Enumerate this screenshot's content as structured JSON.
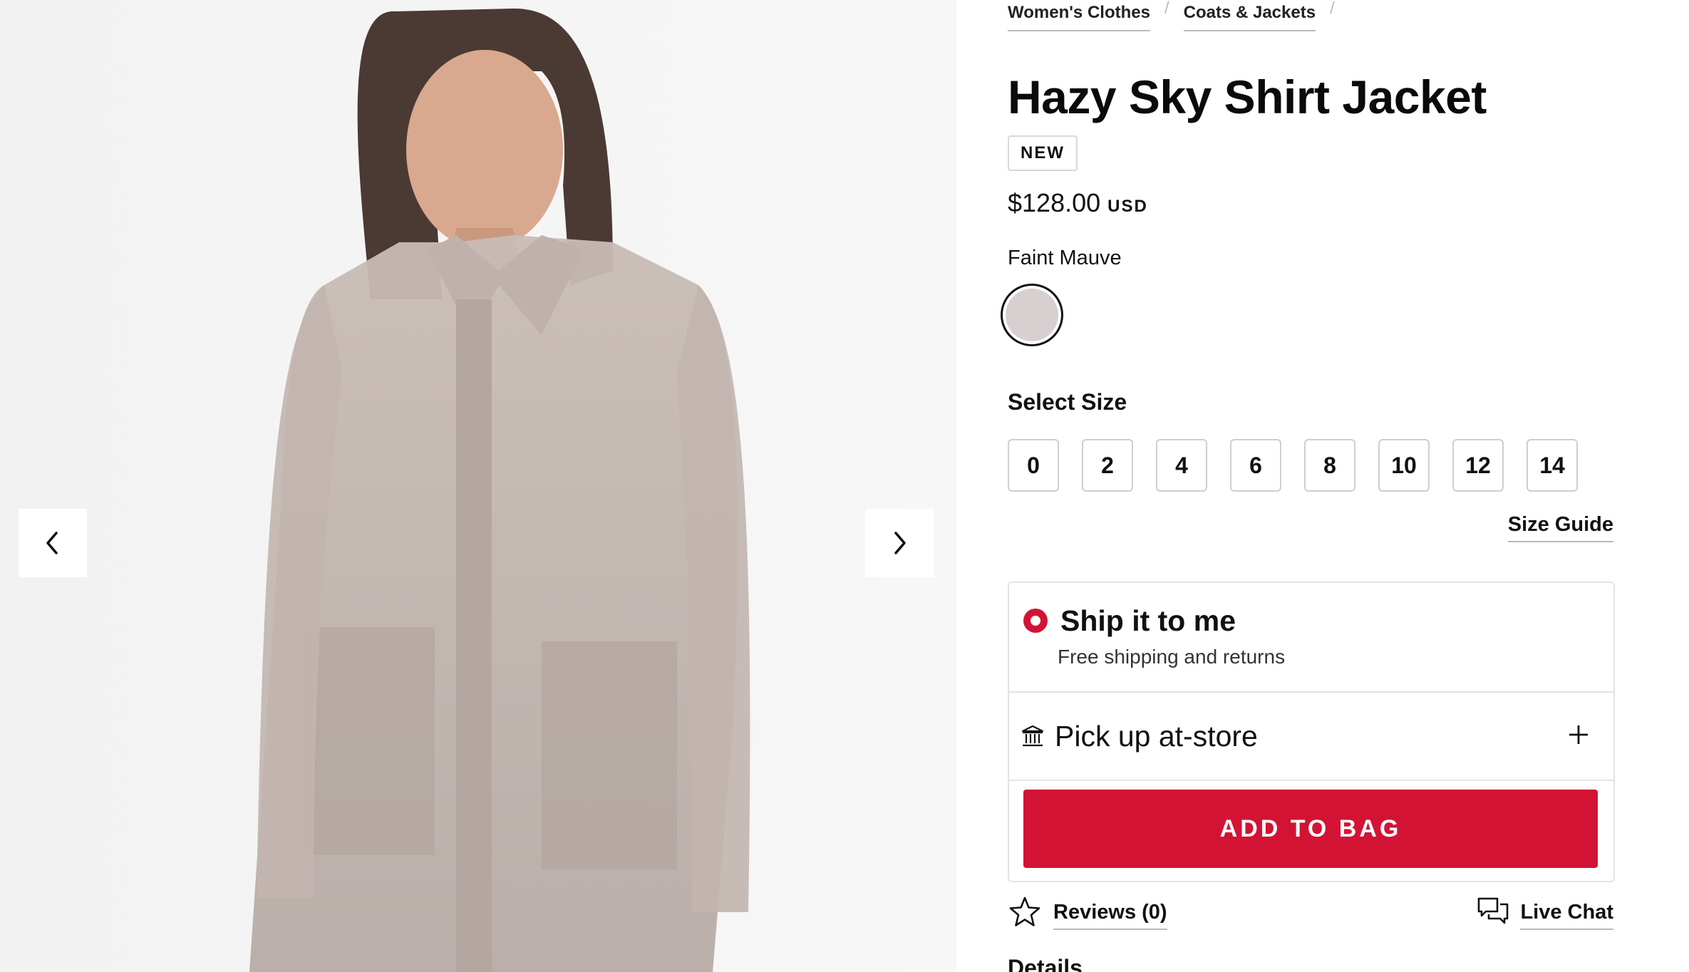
{
  "gallery": {
    "prev_icon": "chevron-left-icon",
    "next_icon": "chevron-right-icon"
  },
  "breadcrumb": [
    "Women's Clothes",
    "Coats & Jackets"
  ],
  "breadcrumb_separator": "/",
  "product": {
    "title": "Hazy Sky Shirt Jacket",
    "badge": "NEW",
    "price": "$128.00",
    "currency": "USD",
    "color_name": "Faint Mauve",
    "swatch_color": "#d8d0d0"
  },
  "size": {
    "label": "Select Size",
    "options": [
      "0",
      "2",
      "4",
      "6",
      "8",
      "10",
      "12",
      "14"
    ],
    "guide_label": "Size Guide"
  },
  "delivery": {
    "ship_title": "Ship it to me",
    "ship_subtitle": "Free shipping and returns",
    "pickup_title": "Pick up at-store",
    "add_to_bag": "ADD TO BAG"
  },
  "footer_links": {
    "reviews": "Reviews (0)",
    "live_chat": "Live Chat"
  },
  "details_heading": "Details",
  "colors": {
    "accent_red": "#d31334",
    "border": "#e3e3e3"
  }
}
